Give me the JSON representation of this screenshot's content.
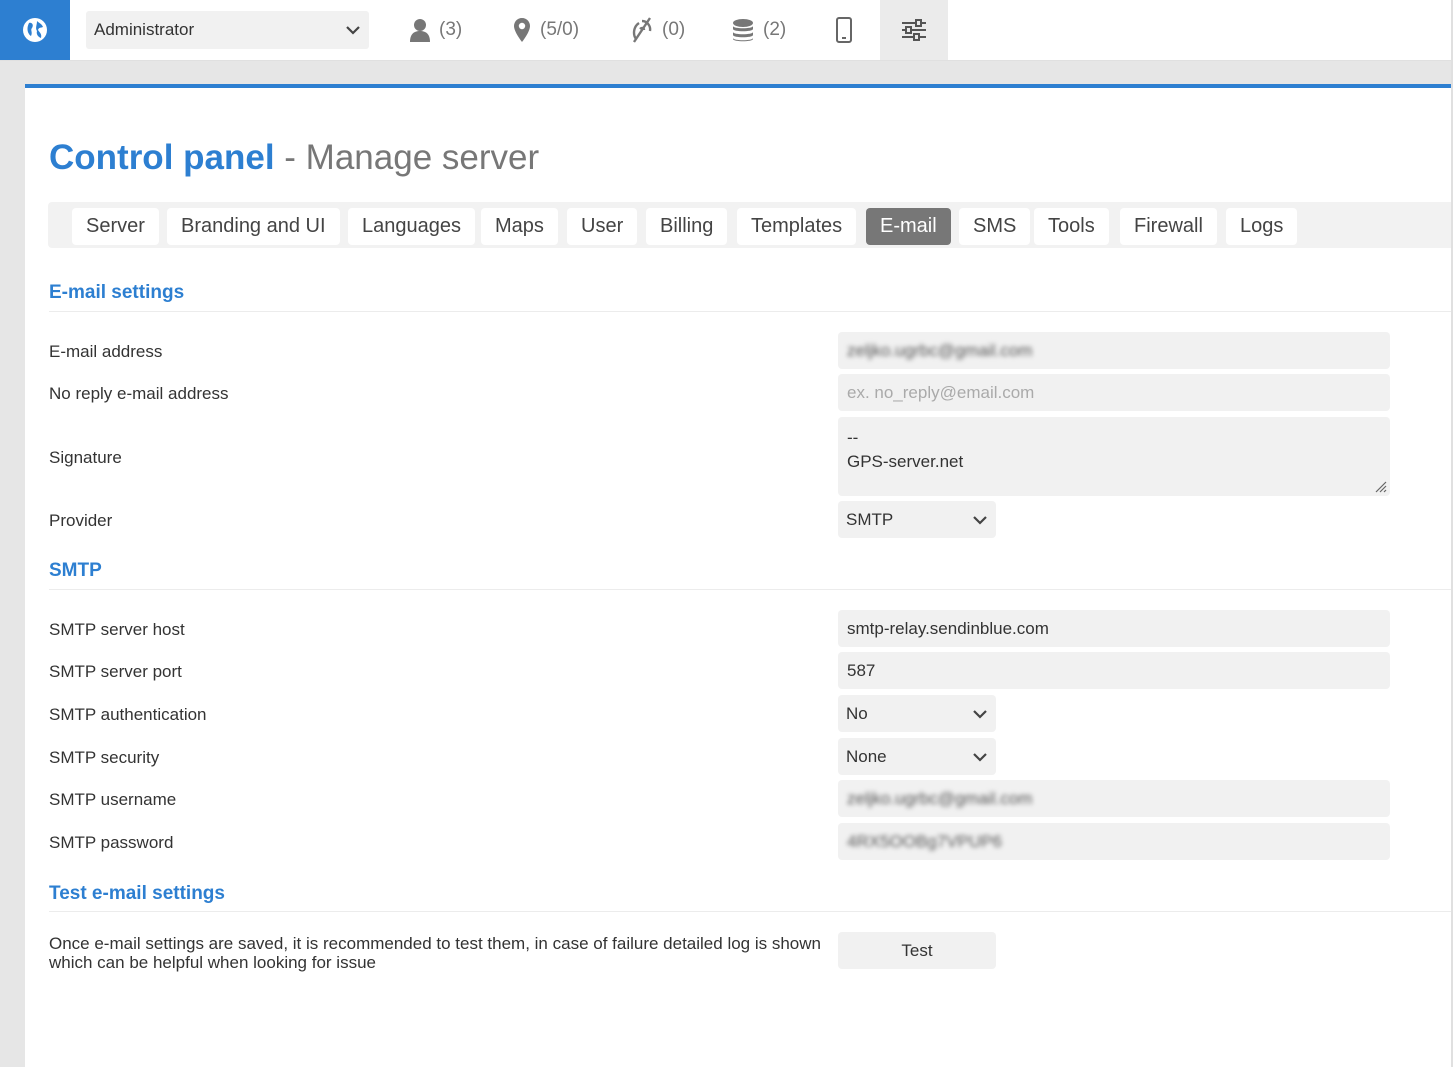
{
  "topbar": {
    "user_selector": "Administrator",
    "users_count": "(3)",
    "objects_count": "(5/0)",
    "events_count": "(0)",
    "billing_count": "(2)"
  },
  "page": {
    "title": "Control panel",
    "subtitle": "- Manage server"
  },
  "tabs": [
    {
      "label": "Server"
    },
    {
      "label": "Branding and UI"
    },
    {
      "label": "Languages"
    },
    {
      "label": "Maps"
    },
    {
      "label": "User"
    },
    {
      "label": "Billing"
    },
    {
      "label": "Templates"
    },
    {
      "label": "E-mail",
      "active": true
    },
    {
      "label": "SMS"
    },
    {
      "label": "Tools"
    },
    {
      "label": "Firewall"
    },
    {
      "label": "Logs"
    }
  ],
  "email_settings": {
    "header": "E-mail settings",
    "email_address_label": "E-mail address",
    "email_address_value": "zeljko.ugrbc@gmail.com",
    "no_reply_label": "No reply e-mail address",
    "no_reply_placeholder": "ex. no_reply@email.com",
    "signature_label": "Signature",
    "signature_line1": "--",
    "signature_line2": "GPS-server.net",
    "provider_label": "Provider",
    "provider_value": "SMTP"
  },
  "smtp": {
    "header": "SMTP",
    "host_label": "SMTP server host",
    "host_value": "smtp-relay.sendinblue.com",
    "port_label": "SMTP server port",
    "port_value": "587",
    "auth_label": "SMTP authentication",
    "auth_value": "No",
    "security_label": "SMTP security",
    "security_value": "None",
    "username_label": "SMTP username",
    "username_value": "zeljko.ugrbc@gmail.com",
    "password_label": "SMTP password",
    "password_value": "4RX5OOBg7VPUP6"
  },
  "test": {
    "header": "Test e-mail settings",
    "help_text": "Once e-mail settings are saved, it is recommended to test them, in case of failure detailed log is shown which can be helpful when looking for issue",
    "button_label": "Test"
  },
  "colors": {
    "accent": "#2d7fd1",
    "active_tab": "#777777",
    "field_bg": "#f1f1f1"
  },
  "icons": [
    "globe-icon",
    "chevron-down-icon",
    "user-icon",
    "map-pin-icon",
    "no-signal-icon",
    "coins-icon",
    "phone-icon",
    "sliders-icon"
  ]
}
